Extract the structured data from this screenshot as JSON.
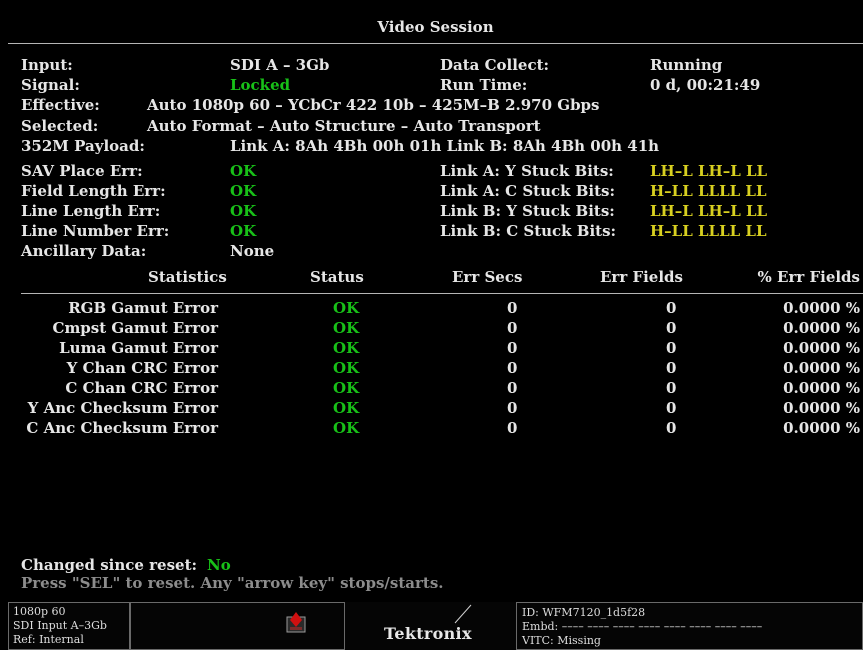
{
  "title": "Video Session",
  "top": {
    "input_label": "Input:",
    "input_value": "SDI A – 3Gb",
    "signal_label": "Signal:",
    "signal_value": "Locked",
    "effective_label": "Effective:",
    "effective_value": "Auto 1080p 60 – YCbCr 422 10b – 425M–B 2.970 Gbps",
    "selected_label": "Selected:",
    "selected_value": "Auto Format – Auto Structure – Auto Transport",
    "payload_label": "352M Payload:",
    "payload_value": "Link A: 8Ah 4Bh 00h 01h   Link B: 8Ah 4Bh 00h 41h",
    "data_collect_label": "Data Collect:",
    "data_collect_value": "Running",
    "run_time_label": "Run Time:",
    "run_time_value": "0 d, 00:21:49"
  },
  "errors": [
    {
      "label": "SAV Place Err:",
      "value": "OK"
    },
    {
      "label": "Field Length Err:",
      "value": "OK"
    },
    {
      "label": "Line Length Err:",
      "value": "OK"
    },
    {
      "label": "Line Number Err:",
      "value": "OK"
    },
    {
      "label": "Ancillary Data:",
      "value": "None"
    }
  ],
  "stuck_bits": [
    {
      "label": "Link A: Y Stuck Bits:",
      "value": "LH–L LH–L LL"
    },
    {
      "label": "Link A: C Stuck Bits:",
      "value": "H–LL LLLL LL"
    },
    {
      "label": "Link B: Y Stuck Bits:",
      "value": "LH–L LH–L LL"
    },
    {
      "label": "Link B: C Stuck Bits:",
      "value": "H–LL LLLL LL"
    }
  ],
  "table": {
    "headers": [
      "Statistics",
      "Status",
      "Err Secs",
      "Err Fields",
      "% Err Fields"
    ],
    "rows": [
      [
        "RGB Gamut Error",
        "OK",
        "0",
        "0",
        "0.0000 %"
      ],
      [
        "Cmpst Gamut Error",
        "OK",
        "0",
        "0",
        "0.0000 %"
      ],
      [
        "Luma Gamut Error",
        "OK",
        "0",
        "0",
        "0.0000 %"
      ],
      [
        "Y Chan CRC Error",
        "OK",
        "0",
        "0",
        "0.0000 %"
      ],
      [
        "C Chan CRC Error",
        "OK",
        "0",
        "0",
        "0.0000 %"
      ],
      [
        "Y Anc Checksum Error",
        "OK",
        "0",
        "0",
        "0.0000 %"
      ],
      [
        "C Anc Checksum Error",
        "OK",
        "0",
        "0",
        "0.0000 %"
      ]
    ]
  },
  "changed_since_reset_label": "Changed since reset:",
  "changed_since_reset_value": "No",
  "hint": "Press \"SEL\" to reset.  Any \"arrow key\" stops/starts.",
  "footer": {
    "format": "1080p 60",
    "input": "SDI Input A–3Gb",
    "ref": "Ref: Internal",
    "brand": "Tektronix",
    "id": "ID: WFM7120_1d5f28",
    "embd": "Embd: –––– –––– –––– –––– –––– –––– –––– ––––",
    "vitc": "VITC: Missing",
    "alarm_icon": "alarm-icon"
  },
  "colors": {
    "ok_green": "#18c018",
    "stuck_yellow": "#d8d020",
    "missing_red": "#e01818",
    "background": "#000000"
  }
}
